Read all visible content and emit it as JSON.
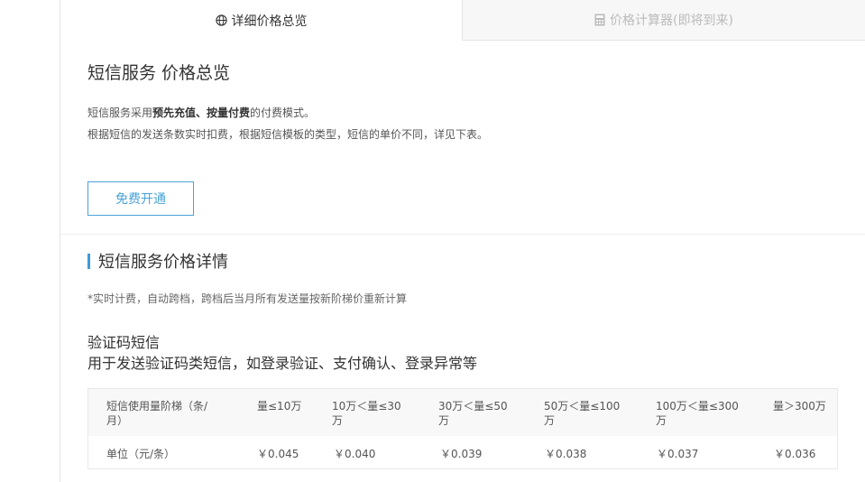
{
  "tabs": {
    "overview_label": "详细价格总览",
    "calculator_label": "价格计算器(即将到来)"
  },
  "overview": {
    "title": "短信服务 价格总览",
    "desc1_prefix": "短信服务采用",
    "desc1_bold": "预先充值、按量付费",
    "desc1_suffix": "的付费模式。",
    "desc2": "根据短信的发送条数实时扣费，根据短信模板的类型，短信的单价不同，详见下表。",
    "open_button_label": "免费开通"
  },
  "details": {
    "title": "短信服务价格详情",
    "note": "*实时计费，自动跨档，跨档后当月所有发送量按新阶梯价重新计算",
    "category_title": "验证码短信",
    "category_desc": "用于发送验证码类短信，如登录验证、支付确认、登录异常等"
  },
  "price_table": {
    "header": [
      "短信使用量阶梯（条/月）",
      "量≤10万",
      "10万＜量≤30万",
      "30万＜量≤50万",
      "50万＜量≤100万",
      "100万＜量≤300万",
      "量＞300万"
    ],
    "row": [
      "单位（元/条）",
      "￥0.045",
      "￥0.040",
      "￥0.039",
      "￥0.038",
      "￥0.037",
      "￥0.036"
    ]
  },
  "colors": {
    "accent": "#4aa3d8",
    "title_bar": "#3d9ad8",
    "disabled_text": "#bbbbbb"
  }
}
